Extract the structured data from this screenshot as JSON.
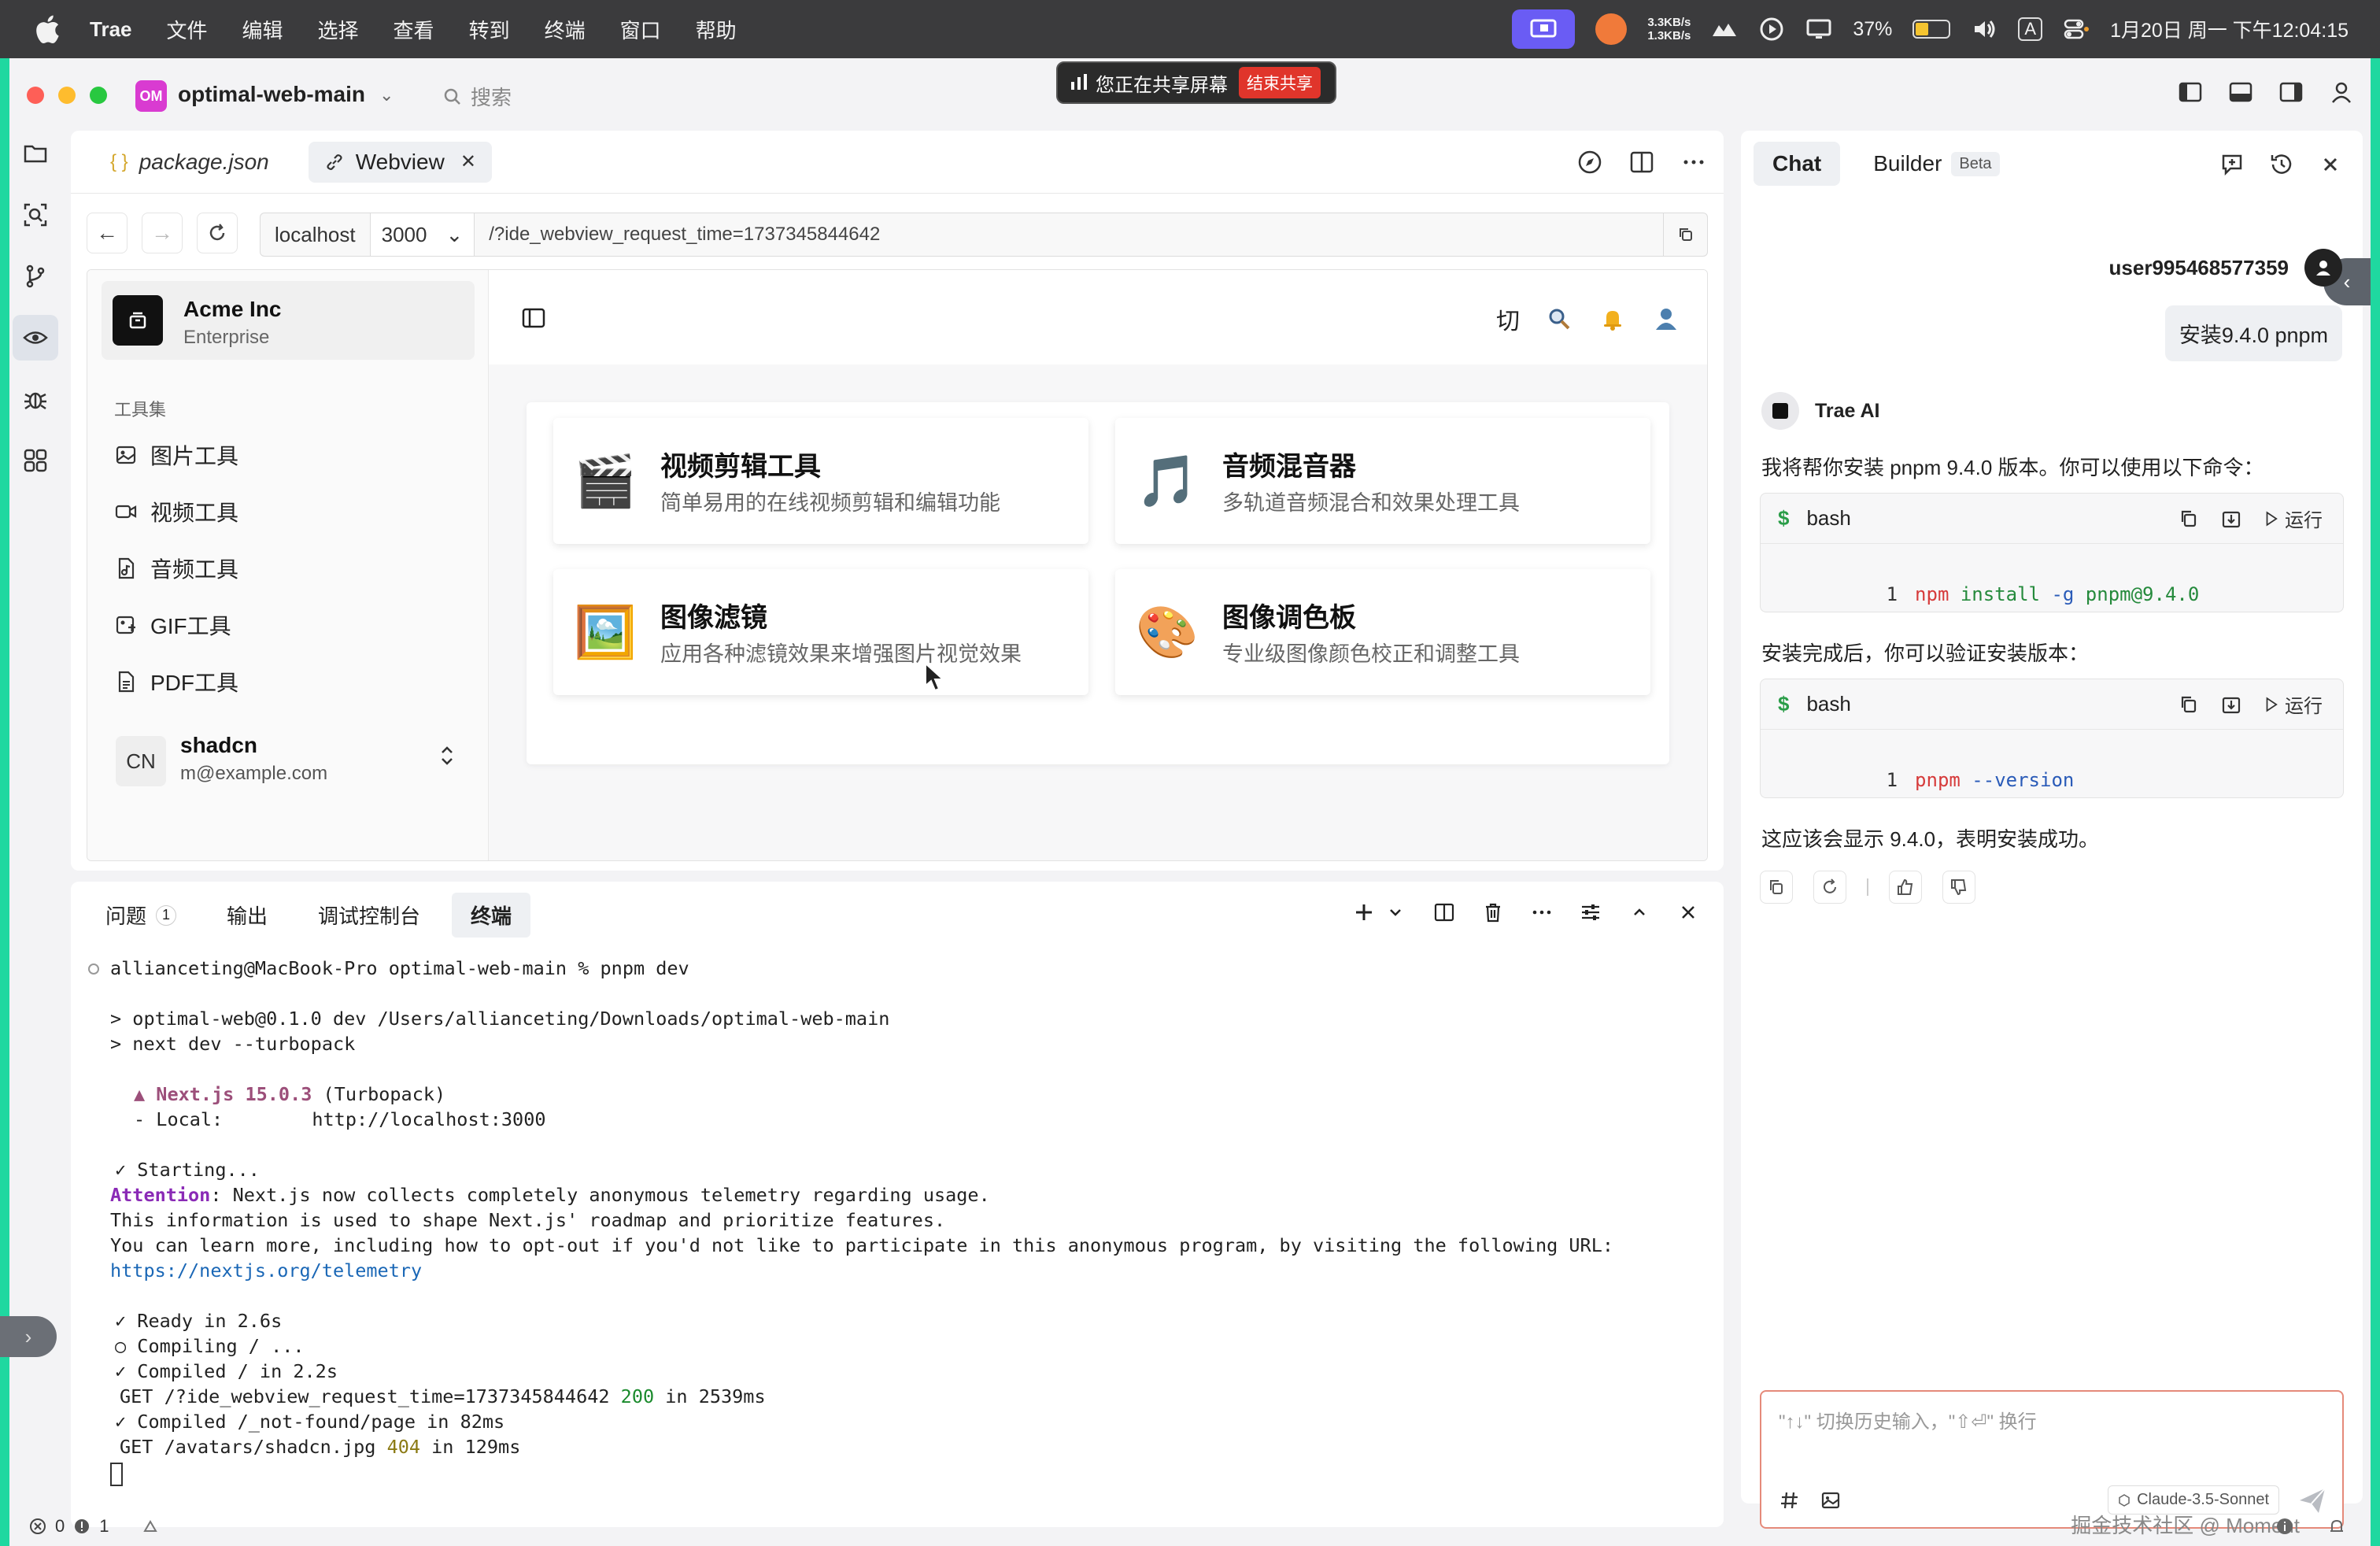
{
  "menubar": {
    "app": "Trae",
    "items": [
      "文件",
      "编辑",
      "选择",
      "查看",
      "转到",
      "终端",
      "窗口",
      "帮助"
    ],
    "net_up": "3.3KB/s",
    "net_down": "1.3KB/s",
    "battery": "37%",
    "ime": "A",
    "clock": "1月20日 周一 下午12:04:15"
  },
  "titlebar": {
    "project_badge": "OM",
    "project_name": "optimal-web-main",
    "search_label": "搜索",
    "share_text": "您正在共享屏幕",
    "share_stop": "结束共享"
  },
  "editor": {
    "tabs": [
      {
        "label": "package.json",
        "icon": "json-braces-icon"
      },
      {
        "label": "Webview",
        "icon": "link-icon"
      }
    ],
    "url": {
      "host": "localhost",
      "port": "3000",
      "path": "/?ide_webview_request_time=1737345844642"
    }
  },
  "webview": {
    "team": {
      "name": "Acme Inc",
      "plan": "Enterprise"
    },
    "group_label": "工具集",
    "tools": [
      {
        "label": "图片工具",
        "icon": "image-icon"
      },
      {
        "label": "视频工具",
        "icon": "video-icon"
      },
      {
        "label": "音频工具",
        "icon": "audio-file-icon"
      },
      {
        "label": "GIF工具",
        "icon": "gif-image-icon"
      },
      {
        "label": "PDF工具",
        "icon": "document-icon"
      }
    ],
    "user": {
      "initials": "CN",
      "name": "shadcn",
      "email": "m@example.com"
    },
    "header_char": "切",
    "cards": [
      {
        "emoji": "🎬",
        "title": "视频剪辑工具",
        "desc": "简单易用的在线视频剪辑和编辑功能"
      },
      {
        "emoji": "🎵",
        "title": "音频混音器",
        "desc": "多轨道音频混合和效果处理工具"
      },
      {
        "emoji": "🖼️",
        "title": "图像滤镜",
        "desc": "应用各种滤镜效果来增强图片视觉效果"
      },
      {
        "emoji": "🎨",
        "title": "图像调色板",
        "desc": "专业级图像颜色校正和调整工具"
      }
    ]
  },
  "panel": {
    "tabs": [
      {
        "label": "问题",
        "badge": "1"
      },
      {
        "label": "输出"
      },
      {
        "label": "调试控制台"
      },
      {
        "label": "终端"
      }
    ],
    "terminal": {
      "prompt": "allianceting@MacBook-Pro optimal-web-main % pnpm dev",
      "l1": "> optimal-web@0.1.0 dev /Users/allianceting/Downloads/optimal-web-main",
      "l2": "> next dev --turbopack",
      "next_version": "▲ Next.js 15.0.3",
      "turbopack": " (Turbopack)",
      "local_label": "- Local:        ",
      "local_url": "http://localhost:3000",
      "starting": "✓ Starting...",
      "attention_label": "Attention",
      "attention_text": ": Next.js now collects completely anonymous telemetry regarding usage.",
      "info1": "This information is used to shape Next.js' roadmap and prioritize features.",
      "info2": "You can learn more, including how to opt-out if you'd not like to participate in this anonymous program, by visiting the following URL:",
      "telemetry_url": "https://nextjs.org/telemetry",
      "ready": "✓ Ready in 2.6s",
      "compiling": "○ Compiling / ...",
      "compiled": "✓ Compiled / in 2.2s",
      "get1": "GET /?ide_webview_request_time=1737345844642 ",
      "get1_status": "200",
      "get1_time": " in 2539ms",
      "compiled2": "✓ Compiled /_not-found/page in 82ms",
      "get2": "GET /avatars/shadcn.jpg ",
      "get2_status": "404",
      "get2_time": " in 129ms"
    }
  },
  "chat": {
    "tabs": [
      {
        "label": "Chat"
      },
      {
        "label": "Builder",
        "badge": "Beta"
      }
    ],
    "username": "user995468577359",
    "user_message": "安装9.4.0 pnpm",
    "ai_name": "Trae AI",
    "msg1": "我将帮你安装 pnpm 9.4.0 版本。你可以使用以下命令：",
    "code1": {
      "lang": "bash",
      "line": "1",
      "cmd": "npm",
      "rest": " install ",
      "flag": "-g",
      "pkg": " pnpm@9.4.0",
      "run": "运行"
    },
    "msg2": "安装完成后，你可以验证安装版本：",
    "code2": {
      "lang": "bash",
      "line": "1",
      "cmd": "pnpm",
      "flag": " --version",
      "run": "运行"
    },
    "msg3": "这应该会显示 9.4.0，表明安装成功。",
    "input_placeholder": "\"↑↓\" 切换历史输入，\"⇧⏎\" 换行",
    "model": "Claude-3.5-Sonnet"
  },
  "statusbar": {
    "errors": "0",
    "warnings": "1",
    "watermark": "掘金技术社区 @ Moment"
  }
}
